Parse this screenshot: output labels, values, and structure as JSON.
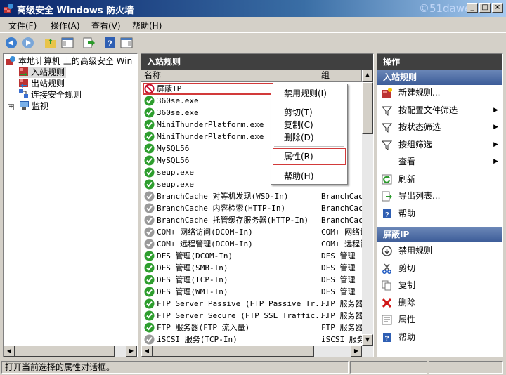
{
  "window": {
    "title": "高级安全 Windows 防火墙",
    "watermark": "©51dawei.net"
  },
  "menu": [
    "文件(F)",
    "操作(A)",
    "查看(V)",
    "帮助(H)"
  ],
  "tree": {
    "root": "本地计算机 上的高级安全 Win",
    "items": [
      "入站规则",
      "出站规则",
      "连接安全规则",
      "监视"
    ],
    "expander": "+"
  },
  "center": {
    "header": "入站规则",
    "columns": [
      "名称",
      "组"
    ],
    "rows": [
      {
        "name": "屏蔽IP",
        "group": "",
        "status": "block"
      },
      {
        "name": "360se.exe",
        "group": "",
        "status": "allow"
      },
      {
        "name": "360se.exe",
        "group": "",
        "status": "allow"
      },
      {
        "name": "MiniThunderPlatform.exe",
        "group": "",
        "status": "allow"
      },
      {
        "name": "MiniThunderPlatform.exe",
        "group": "",
        "status": "allow"
      },
      {
        "name": "MySQL56",
        "group": "",
        "status": "allow"
      },
      {
        "name": "MySQL56",
        "group": "",
        "status": "allow"
      },
      {
        "name": "seup.exe",
        "group": "",
        "status": "allow"
      },
      {
        "name": "seup.exe",
        "group": "",
        "status": "allow"
      },
      {
        "name": "BranchCache 对等机发现(WSD-In)",
        "group": "BranchCach",
        "status": "disabled"
      },
      {
        "name": "BranchCache 内容检索(HTTP-In)",
        "group": "BranchCach",
        "status": "disabled"
      },
      {
        "name": "BranchCache 托管缓存服务器(HTTP-In)",
        "group": "BranchCach",
        "status": "disabled"
      },
      {
        "name": "COM+ 网络访问(DCOM-In)",
        "group": "COM+ 网络访",
        "status": "disabled"
      },
      {
        "name": "COM+ 远程管理(DCOM-In)",
        "group": "COM+ 远程管",
        "status": "disabled"
      },
      {
        "name": "DFS 管理(DCOM-In)",
        "group": "DFS 管理",
        "status": "allow"
      },
      {
        "name": "DFS 管理(SMB-In)",
        "group": "DFS 管理",
        "status": "allow"
      },
      {
        "name": "DFS 管理(TCP-In)",
        "group": "DFS 管理",
        "status": "allow"
      },
      {
        "name": "DFS 管理(WMI-In)",
        "group": "DFS 管理",
        "status": "allow"
      },
      {
        "name": "FTP Server Passive (FTP Passive Tr...",
        "group": "FTP 服务器",
        "status": "allow"
      },
      {
        "name": "FTP Server Secure (FTP SSL Traffic...",
        "group": "FTP 服务器",
        "status": "allow"
      },
      {
        "name": "FTP 服务器(FTP 流入量)",
        "group": "FTP 服务器",
        "status": "allow"
      },
      {
        "name": "iSCSI 服务(TCP-In)",
        "group": "iSCSI 服务",
        "status": "disabled"
      }
    ]
  },
  "context_menu": {
    "items": [
      "禁用规则(I)",
      "剪切(T)",
      "复制(C)",
      "删除(D)",
      "属性(R)",
      "帮助(H)"
    ],
    "highlighted": "属性(R)"
  },
  "actions": {
    "header": "操作",
    "section1": "入站规则",
    "items1": [
      {
        "label": "新建规则...",
        "icon": "new-rule-icon",
        "submenu": false
      },
      {
        "label": "按配置文件筛选",
        "icon": "filter-icon",
        "submenu": true
      },
      {
        "label": "按状态筛选",
        "icon": "filter-icon",
        "submenu": true
      },
      {
        "label": "按组筛选",
        "icon": "filter-icon",
        "submenu": true
      },
      {
        "label": "查看",
        "icon": "",
        "submenu": true
      },
      {
        "label": "刷新",
        "icon": "refresh-icon",
        "submenu": false
      },
      {
        "label": "导出列表...",
        "icon": "export-icon",
        "submenu": false
      },
      {
        "label": "帮助",
        "icon": "help-icon",
        "submenu": false
      }
    ],
    "section2": "屏蔽IP",
    "items2": [
      {
        "label": "禁用规则",
        "icon": "disable-icon"
      },
      {
        "label": "剪切",
        "icon": "cut-icon"
      },
      {
        "label": "复制",
        "icon": "copy-icon"
      },
      {
        "label": "删除",
        "icon": "delete-icon"
      },
      {
        "label": "属性",
        "icon": "properties-icon"
      },
      {
        "label": "帮助",
        "icon": "help-icon"
      }
    ]
  },
  "status": {
    "text": "打开当前选择的属性对话框。"
  },
  "colors": {
    "allow": "#2e9e2e",
    "block": "#c8102e",
    "disabled": "#9a9a9a",
    "highlight": "#d23a3a"
  }
}
